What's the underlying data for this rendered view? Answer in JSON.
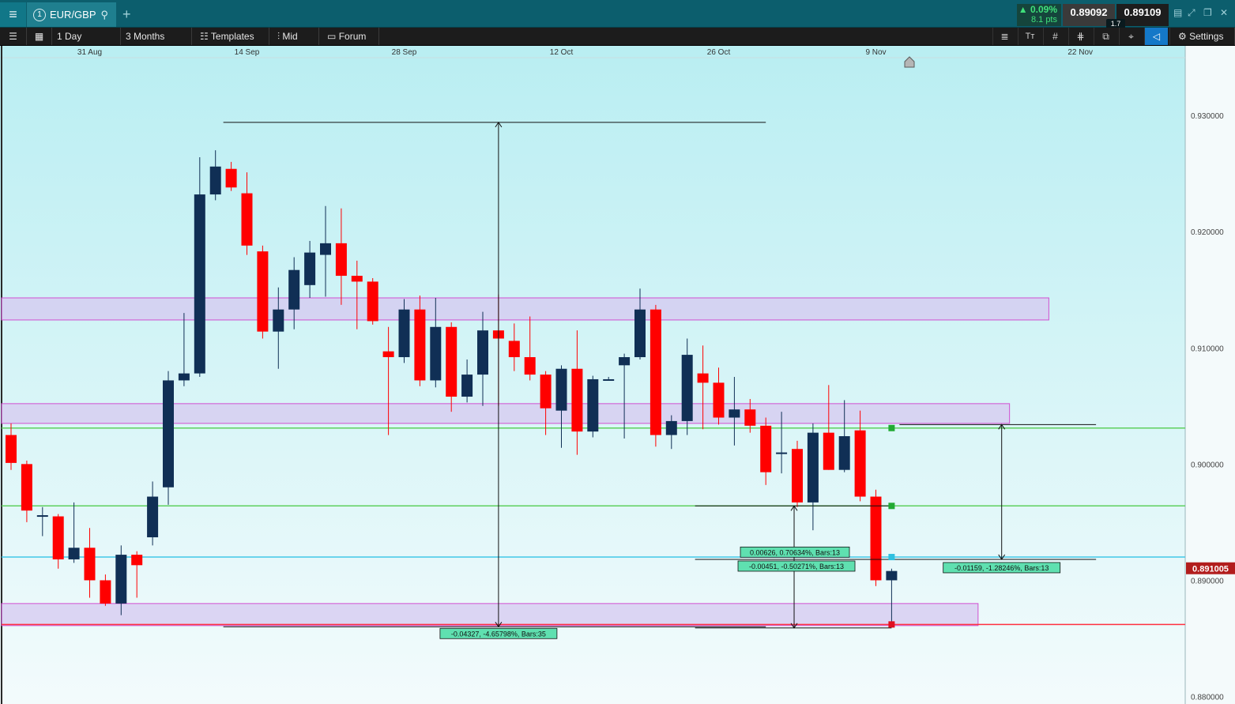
{
  "topbar": {
    "menu_icon": "hamburger-icon",
    "tab_number": "1",
    "symbol": "EUR/GBP",
    "search_icon": "search-icon",
    "add_icon": "plus-icon",
    "change_pct": "▲ 0.09%",
    "change_pts": "8.1 pts",
    "bid": "0.89092",
    "ask": "0.89109",
    "spread": "1.7",
    "colors": {
      "bar": "#0c5e6d",
      "up": "#3fe07a"
    }
  },
  "toolbar": {
    "timeframe": "1 Day",
    "range": "3 Months",
    "templates": "Templates",
    "price_type": "Mid",
    "forum": "Forum",
    "settings": "Settings"
  },
  "chart_data": {
    "type": "candlestick",
    "x_tick_labels": [
      "31 Aug",
      "14 Sep",
      "28 Sep",
      "12 Oct",
      "26 Oct",
      "9 Nov",
      "22 Nov"
    ],
    "y_tick_labels": [
      "0.930000",
      "0.920000",
      "0.910000",
      "0.900000",
      "0.890000",
      "0.880000"
    ],
    "ylim": [
      0.8799,
      0.9315
    ],
    "current_price_label": "0.891005",
    "colors": {
      "up": "#102f55",
      "down": "#ff0000",
      "zone": "#d5c8f0",
      "zone_border": "#d14fd1"
    },
    "candles": [
      {
        "o": 0.9025,
        "h": 0.9035,
        "l": 0.8995,
        "c": 0.9001
      },
      {
        "o": 0.9,
        "h": 0.9003,
        "l": 0.895,
        "c": 0.896
      },
      {
        "o": 0.8955,
        "h": 0.8963,
        "l": 0.8938,
        "c": 0.8956
      },
      {
        "o": 0.8955,
        "h": 0.8957,
        "l": 0.891,
        "c": 0.8918
      },
      {
        "o": 0.8918,
        "h": 0.8967,
        "l": 0.8915,
        "c": 0.8928
      },
      {
        "o": 0.8928,
        "h": 0.8945,
        "l": 0.8885,
        "c": 0.89
      },
      {
        "o": 0.89,
        "h": 0.8905,
        "l": 0.8878,
        "c": 0.888
      },
      {
        "o": 0.888,
        "h": 0.893,
        "l": 0.887,
        "c": 0.8922
      },
      {
        "o": 0.8922,
        "h": 0.8925,
        "l": 0.8885,
        "c": 0.8913
      },
      {
        "o": 0.8937,
        "h": 0.8985,
        "l": 0.893,
        "c": 0.8972
      },
      {
        "o": 0.898,
        "h": 0.908,
        "l": 0.8965,
        "c": 0.9072
      },
      {
        "o": 0.9072,
        "h": 0.913,
        "l": 0.9067,
        "c": 0.9078
      },
      {
        "o": 0.9078,
        "h": 0.9264,
        "l": 0.9075,
        "c": 0.9232
      },
      {
        "o": 0.9232,
        "h": 0.927,
        "l": 0.9227,
        "c": 0.9256
      },
      {
        "o": 0.9254,
        "h": 0.926,
        "l": 0.9235,
        "c": 0.9238
      },
      {
        "o": 0.9233,
        "h": 0.9251,
        "l": 0.918,
        "c": 0.9188
      },
      {
        "o": 0.9183,
        "h": 0.9188,
        "l": 0.9108,
        "c": 0.9114
      },
      {
        "o": 0.9114,
        "h": 0.9152,
        "l": 0.9082,
        "c": 0.9133
      },
      {
        "o": 0.9133,
        "h": 0.9178,
        "l": 0.9116,
        "c": 0.9167
      },
      {
        "o": 0.9154,
        "h": 0.9192,
        "l": 0.9143,
        "c": 0.9182
      },
      {
        "o": 0.918,
        "h": 0.9222,
        "l": 0.9144,
        "c": 0.919
      },
      {
        "o": 0.919,
        "h": 0.922,
        "l": 0.9137,
        "c": 0.9162
      },
      {
        "o": 0.9162,
        "h": 0.9175,
        "l": 0.9116,
        "c": 0.9157
      },
      {
        "o": 0.9157,
        "h": 0.916,
        "l": 0.912,
        "c": 0.9123
      },
      {
        "o": 0.9097,
        "h": 0.9118,
        "l": 0.9025,
        "c": 0.9092
      },
      {
        "o": 0.9092,
        "h": 0.9142,
        "l": 0.9087,
        "c": 0.9133
      },
      {
        "o": 0.9133,
        "h": 0.9145,
        "l": 0.9067,
        "c": 0.9072
      },
      {
        "o": 0.9072,
        "h": 0.9143,
        "l": 0.9066,
        "c": 0.9118
      },
      {
        "o": 0.9118,
        "h": 0.9122,
        "l": 0.9045,
        "c": 0.9058
      },
      {
        "o": 0.9058,
        "h": 0.909,
        "l": 0.9053,
        "c": 0.9077
      },
      {
        "o": 0.9077,
        "h": 0.9131,
        "l": 0.905,
        "c": 0.9115
      },
      {
        "o": 0.9115,
        "h": 0.9146,
        "l": 0.905,
        "c": 0.9108
      },
      {
        "o": 0.9106,
        "h": 0.9121,
        "l": 0.908,
        "c": 0.9092
      },
      {
        "o": 0.9092,
        "h": 0.9127,
        "l": 0.9072,
        "c": 0.9077
      },
      {
        "o": 0.9077,
        "h": 0.908,
        "l": 0.9025,
        "c": 0.9048
      },
      {
        "o": 0.9046,
        "h": 0.9085,
        "l": 0.9014,
        "c": 0.9082
      },
      {
        "o": 0.9082,
        "h": 0.9115,
        "l": 0.9008,
        "c": 0.9028
      },
      {
        "o": 0.9028,
        "h": 0.9076,
        "l": 0.9023,
        "c": 0.9073
      },
      {
        "o": 0.9073,
        "h": 0.9075,
        "l": 0.9073,
        "c": 0.9073
      },
      {
        "o": 0.9085,
        "h": 0.9095,
        "l": 0.9022,
        "c": 0.9092
      },
      {
        "o": 0.9092,
        "h": 0.9151,
        "l": 0.909,
        "c": 0.9133
      },
      {
        "o": 0.9133,
        "h": 0.9137,
        "l": 0.9015,
        "c": 0.9025
      },
      {
        "o": 0.9025,
        "h": 0.9042,
        "l": 0.9013,
        "c": 0.9037
      },
      {
        "o": 0.9037,
        "h": 0.9108,
        "l": 0.9025,
        "c": 0.9094
      },
      {
        "o": 0.9078,
        "h": 0.9102,
        "l": 0.903,
        "c": 0.907
      },
      {
        "o": 0.907,
        "h": 0.9083,
        "l": 0.9034,
        "c": 0.904
      },
      {
        "o": 0.904,
        "h": 0.9075,
        "l": 0.9016,
        "c": 0.9047
      },
      {
        "o": 0.9047,
        "h": 0.9056,
        "l": 0.9027,
        "c": 0.9033
      },
      {
        "o": 0.9033,
        "h": 0.904,
        "l": 0.8982,
        "c": 0.8993
      },
      {
        "o": 0.901,
        "h": 0.9045,
        "l": 0.8992,
        "c": 0.901
      },
      {
        "o": 0.9013,
        "h": 0.902,
        "l": 0.8963,
        "c": 0.8967
      },
      {
        "o": 0.8967,
        "h": 0.9035,
        "l": 0.8943,
        "c": 0.9027
      },
      {
        "o": 0.9027,
        "h": 0.9068,
        "l": 0.8995,
        "c": 0.8995
      },
      {
        "o": 0.8995,
        "h": 0.9055,
        "l": 0.8993,
        "c": 0.9024
      },
      {
        "o": 0.9029,
        "h": 0.9046,
        "l": 0.8968,
        "c": 0.8972
      },
      {
        "o": 0.8972,
        "h": 0.8978,
        "l": 0.8895,
        "c": 0.89
      },
      {
        "o": 0.89,
        "h": 0.891,
        "l": 0.8864,
        "c": 0.8908
      }
    ],
    "zones": [
      {
        "top": 0.9143,
        "bottom": 0.9124,
        "end_index": 66
      },
      {
        "top": 0.9052,
        "bottom": 0.9035,
        "end_index": 63.5
      },
      {
        "top": 0.888,
        "bottom": 0.8861,
        "end_index": 61.5
      }
    ],
    "horizontal_lines": [
      {
        "y": 0.9031,
        "color": "#5ed05e"
      },
      {
        "y": 0.8964,
        "color": "#5ed05e"
      },
      {
        "y": 0.892,
        "color": "#40c8e8"
      },
      {
        "y": 0.8862,
        "color": "#ff3040"
      }
    ],
    "measurements": [
      {
        "label": "-0.04327, -4.65798%, Bars:35",
        "from_index": 13.5,
        "to_index": 48,
        "top": 0.9294,
        "bottom": 0.886,
        "arrow_index": 31
      },
      {
        "label": "0.00626, 0.70634%, Bars:13",
        "from_index": 43.5,
        "to_index": 56,
        "top": 0.8964,
        "bottom": 0.8859,
        "arrow_index": 49.8
      },
      {
        "label": "-0.00451, -0.50271%, Bars:13",
        "from_index": 43.5,
        "to_index": 69,
        "top": 0.8918,
        "bottom": 0.8918,
        "arrow_index": 49.8
      },
      {
        "label": "-0.01159, -1.28246%, Bars:13",
        "from_index": 56.5,
        "to_index": 69,
        "top": 0.9034,
        "bottom": 0.8918,
        "arrow_index": 63
      }
    ]
  }
}
